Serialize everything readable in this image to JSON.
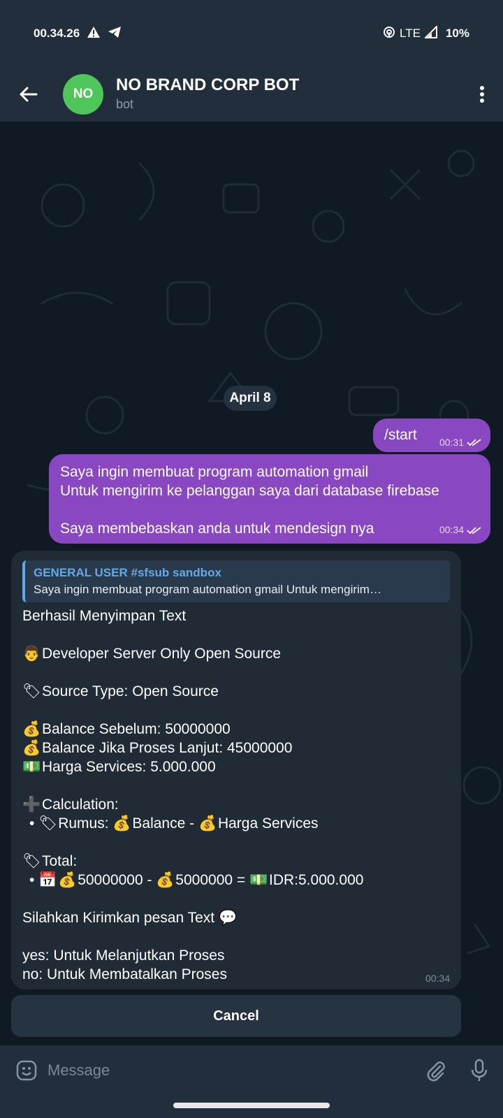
{
  "status": {
    "time": "00.34.26",
    "network": "LTE",
    "battery": "10%"
  },
  "header": {
    "avatar_initials": "NO",
    "title": "NO BRAND CORP BOT",
    "subtitle": "bot"
  },
  "chat": {
    "date": "April 8",
    "outgoing": [
      {
        "text": "/start",
        "time": "00:31"
      },
      {
        "lines": [
          "Saya ingin membuat program automation gmail",
          "Untuk mengirim ke pelanggan saya dari database firebase",
          "",
          "Saya membebaskan anda untuk mendesign nya"
        ],
        "time": "00:34"
      }
    ],
    "incoming": {
      "reply_name": "GENERAL USER #sfsub sandbox",
      "reply_text": "Saya ingin membuat program automation gmail Untuk mengirim…",
      "line_saved": "Berhasil Menyimpan Text",
      "line_dev": "Developer Server Only Open Source",
      "line_source": "Source Type: Open Source",
      "line_bal_before": "Balance Sebelum: 50000000",
      "line_bal_after": "Balance Jika Proses Lanjut: 45000000",
      "line_price": "Harga Services: 5.000.000",
      "line_calc": "Calculation:",
      "line_rumus_label": "Rumus:",
      "line_rumus_a": "Balance -",
      "line_rumus_b": "Harga Services",
      "line_total": "Total:",
      "line_total_a": "50000000 -",
      "line_total_b": "5000000 =",
      "line_total_c": "IDR:5.000.000",
      "line_send": "Silahkan Kirimkan pesan Text",
      "line_yes": "yes: Untuk Melanjutkan Proses",
      "line_no": "no: Untuk Membatalkan Proses",
      "time": "00:34"
    },
    "cancel_label": "Cancel"
  },
  "input": {
    "placeholder": "Message"
  },
  "colors": {
    "header_bg": "#232e3c",
    "chat_bg": "#0f1a24",
    "out_bubble": "#8a47c2",
    "in_bubble": "#202b36",
    "avatar": "#4fc65a",
    "reply_accent": "#64a9e6"
  }
}
